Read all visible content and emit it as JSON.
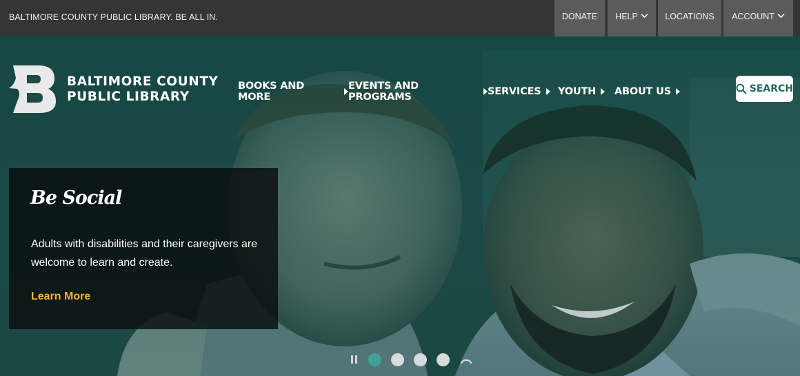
{
  "topbar": {
    "tagline": "BALTIMORE COUNTY PUBLIC LIBRARY. BE ALL IN.",
    "links": [
      {
        "label": "DONATE",
        "dropdown": false
      },
      {
        "label": "HELP",
        "dropdown": true
      },
      {
        "label": "LOCATIONS",
        "dropdown": false
      },
      {
        "label": "ACCOUNT",
        "dropdown": true
      }
    ]
  },
  "brand": {
    "line1": "BALTIMORE COUNTY",
    "line2": "PUBLIC LIBRARY",
    "logo_icon": "b-letter-logo-icon"
  },
  "nav": {
    "items": [
      {
        "label": "BOOKS AND MORE"
      },
      {
        "label": "EVENTS AND PROGRAMS"
      },
      {
        "label": "SERVICES"
      },
      {
        "label": "YOUTH"
      },
      {
        "label": "ABOUT US"
      }
    ],
    "search_label": "SEARCH",
    "search_icon": "search-icon"
  },
  "hero": {
    "title": "Be Social",
    "body": "Adults with disabilities and their caregivers are welcome to learn and create.",
    "link": "Learn More"
  },
  "carousel": {
    "slide_count": 4,
    "active_index": 0
  },
  "colors": {
    "topbar": "#353535",
    "utility_button": "#5b5b5b",
    "accent_teal": "#3fa399",
    "link_gold": "#f5b335",
    "search_text": "#1f6a63"
  }
}
